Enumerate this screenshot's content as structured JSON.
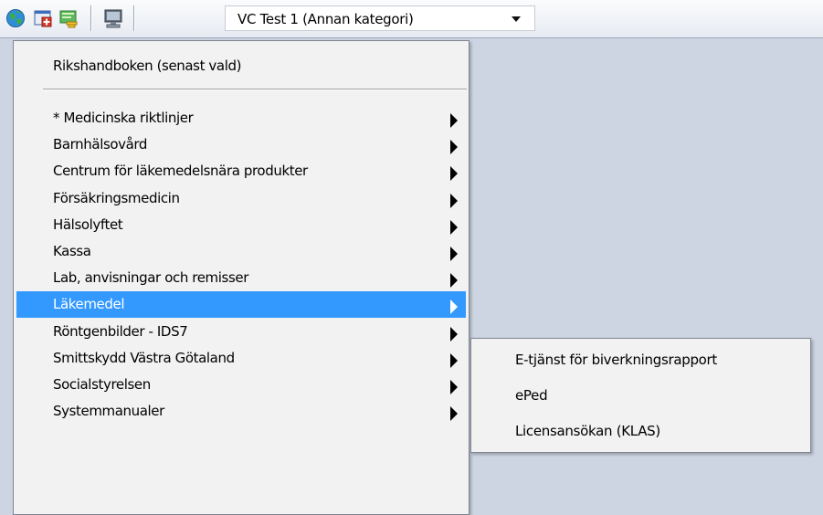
{
  "toolbar": {
    "icons": [
      "globe-icon",
      "add-document-icon",
      "notes-icon",
      "computer-icon"
    ],
    "category_select": {
      "value": "VC Test 1 (Annan kategori)"
    }
  },
  "menu": {
    "header_item": "Rikshandboken  (senast vald)",
    "items": [
      {
        "label": "* Medicinska riktlinjer",
        "has_submenu": true
      },
      {
        "label": "Barnhälsovård",
        "has_submenu": true
      },
      {
        "label": "Centrum för läkemedelsnära produkter",
        "has_submenu": true
      },
      {
        "label": "Försäkringsmedicin",
        "has_submenu": true
      },
      {
        "label": "Hälsolyftet",
        "has_submenu": true
      },
      {
        "label": "Kassa",
        "has_submenu": true
      },
      {
        "label": "Lab, anvisningar och remisser",
        "has_submenu": true
      },
      {
        "label": "Läkemedel",
        "has_submenu": true,
        "selected": true
      },
      {
        "label": "Röntgenbilder - IDS7",
        "has_submenu": true
      },
      {
        "label": "Smittskydd Västra Götaland",
        "has_submenu": true
      },
      {
        "label": "Socialstyrelsen",
        "has_submenu": true
      },
      {
        "label": "Systemmanualer",
        "has_submenu": true
      }
    ]
  },
  "submenu": {
    "items": [
      {
        "label": "E-tjänst för biverkningsrapport"
      },
      {
        "label": "ePed"
      },
      {
        "label": "Licensansökan (KLAS)"
      }
    ]
  },
  "colors": {
    "selection": "#3399ff",
    "menu_bg": "#f2f2f2",
    "desktop_bg": "#cdd5e2"
  }
}
